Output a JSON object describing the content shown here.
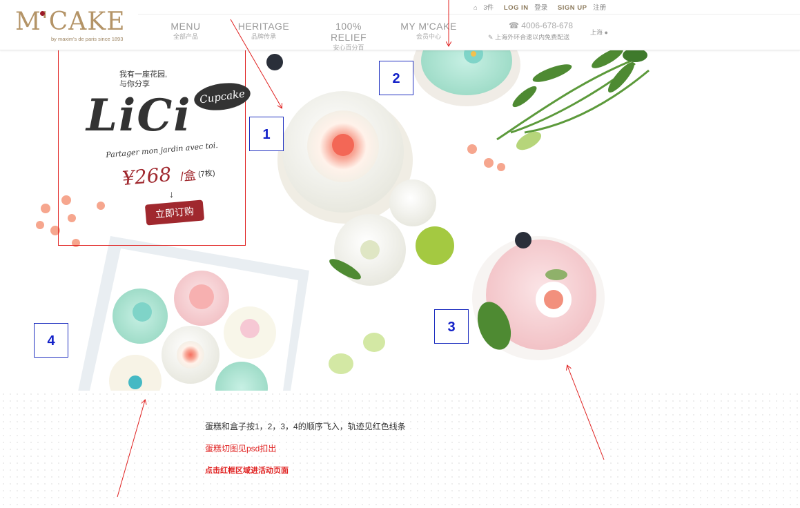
{
  "header": {
    "logo": {
      "text": "M'CAKE",
      "tagline": "by maxim's de paris since 1893"
    },
    "cart": {
      "count": "3件"
    },
    "login": {
      "en": "LOG IN",
      "cn": "登录"
    },
    "signup": {
      "en": "SIGN UP",
      "cn": "注册"
    },
    "nav": [
      {
        "en": "MENU",
        "cn": "全部产品"
      },
      {
        "en": "HERITAGE",
        "cn": "品牌传承"
      },
      {
        "en": "100% RELIEF",
        "cn": "安心百分百"
      },
      {
        "en": "MY M'CAKE",
        "cn": "会员中心"
      }
    ],
    "phone": "4006-678-678",
    "delivery": "上海外环合速以内免费配送",
    "city": "上海"
  },
  "promo": {
    "subtitle_line1": "我有一座花园,",
    "subtitle_line2": "与你分享",
    "badge": "Cupcake",
    "name": "LiCi",
    "french": "Partager mon jardin avec toi.",
    "price": "¥268",
    "unit": "/盒",
    "count": "(7枚)",
    "arrow": "↓",
    "button": "立即订购"
  },
  "markers": [
    "1",
    "2",
    "3",
    "4"
  ],
  "notes": {
    "line1": "蛋糕和盒子按1，2，3，4的顺序飞入，轨迹见红色线条",
    "line2": "蛋糕切图见psd扣出",
    "line3": "点击红框区域进活动页面"
  },
  "colors": {
    "brand_gold": "#b49467",
    "brand_red": "#9c1b27",
    "annotation_red": "#e0201f",
    "marker_blue": "#1220c8"
  }
}
